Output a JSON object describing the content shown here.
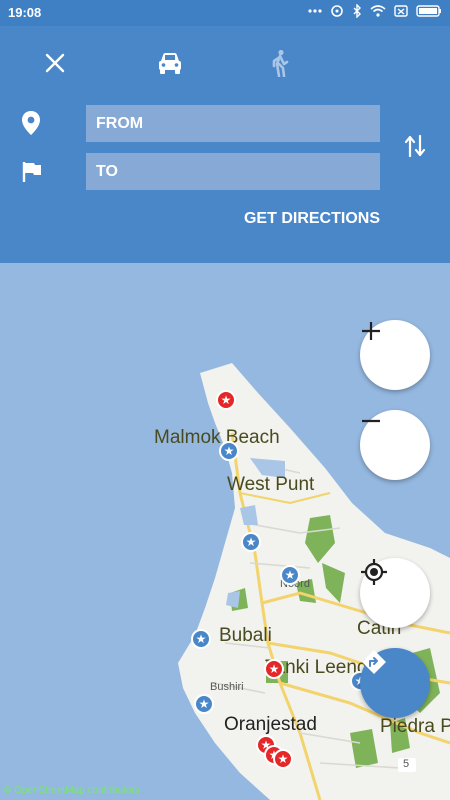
{
  "status_bar": {
    "time": "19:08",
    "icons": [
      "more-dots-icon",
      "sync-icon",
      "bluetooth-icon",
      "wifi-icon",
      "sim-icon",
      "battery-icon"
    ]
  },
  "header": {
    "modes": [
      {
        "name": "close-icon"
      },
      {
        "name": "car-icon",
        "active": true
      },
      {
        "name": "walk-icon",
        "active": false
      }
    ],
    "from_placeholder": "FROM",
    "to_placeholder": "TO",
    "get_directions": "GET DIRECTIONS",
    "swap_icon": "swap-icon"
  },
  "map": {
    "labels": {
      "malmok": "Malmok Beach",
      "westpunt": "West Punt",
      "noord": "Noord",
      "bubali": "Bubali",
      "bushiri": "Bushiri",
      "tankileendert": "Tanki Leendert",
      "catin": "Catin",
      "oranjestad": "Oranjestad",
      "piedra": "Piedra Pl",
      "road5": "5"
    },
    "attribution": "© OpenStreetMap contributors",
    "colors": {
      "water": "#95b8e0",
      "land": "#f2f2ee",
      "green": "#7fb35a",
      "accent": "#4a87c8",
      "red_marker": "#e52727"
    }
  },
  "controls": {
    "zoom_in": "+",
    "zoom_out": "−"
  }
}
